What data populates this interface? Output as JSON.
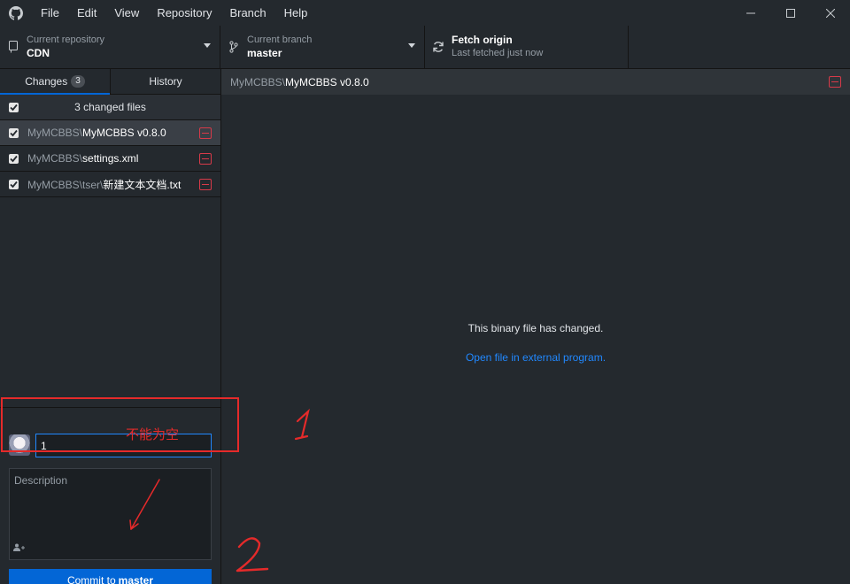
{
  "menu": [
    "File",
    "Edit",
    "View",
    "Repository",
    "Branch",
    "Help"
  ],
  "window_controls": [
    "minimize-icon",
    "maximize-icon",
    "close-icon"
  ],
  "toolbar": {
    "repo_label": "Current repository",
    "repo_value": "CDN",
    "branch_label": "Current branch",
    "branch_value": "master",
    "fetch_label": "Fetch origin",
    "fetch_status": "Last fetched just now"
  },
  "tabs": {
    "changes": "Changes",
    "changes_count": "3",
    "history": "History"
  },
  "files": {
    "header": "3 changed files",
    "items": [
      {
        "dir": "MyMCBBS\\",
        "name": "MyMCBBS v0.8.0",
        "selected": true
      },
      {
        "dir": "MyMCBBS\\",
        "name": "settings.xml",
        "selected": false
      },
      {
        "dir": "MyMCBBS\\tser\\",
        "name": "新建文本文档.txt",
        "selected": false
      }
    ]
  },
  "commit": {
    "summary_value": "1",
    "description_placeholder": "Description",
    "button_prefix": "Commit to",
    "button_branch": "master"
  },
  "main": {
    "path_dir": "MyMCBBS\\",
    "path_name": "MyMCBBS v0.8.0",
    "binary_message": "This binary file has changed.",
    "open_external": "Open file in external program."
  },
  "annotations": {
    "note": "不能为空",
    "marker_1": "1",
    "marker_2": "2",
    "color": "#e52a2a"
  },
  "colors": {
    "background": "#24292e",
    "accent": "#0366d6",
    "link": "#2188ff",
    "removed": "#d73a49"
  }
}
